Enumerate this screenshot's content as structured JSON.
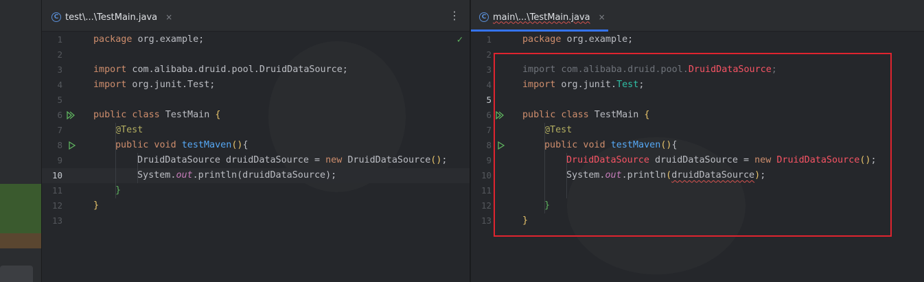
{
  "left_pane": {
    "tab": {
      "icon": "class-c-icon",
      "label": "test\\...\\TestMain.java",
      "close": "×"
    },
    "menu_icon": "⋮",
    "status_icon": "✓",
    "lines": [
      {
        "n": "1",
        "t": "package org.example;"
      },
      {
        "n": "2",
        "t": ""
      },
      {
        "n": "3",
        "t": "import com.alibaba.druid.pool.DruidDataSource;"
      },
      {
        "n": "4",
        "t": "import org.junit.Test;"
      },
      {
        "n": "5",
        "t": ""
      },
      {
        "n": "6",
        "t": "public class TestMain {"
      },
      {
        "n": "7",
        "t": "@Test"
      },
      {
        "n": "8",
        "t": "public void testMaven(){"
      },
      {
        "n": "9",
        "t": "DruidDataSource druidDataSource = new DruidDataSource();"
      },
      {
        "n": "10",
        "t": "System.out.println(druidDataSource);"
      },
      {
        "n": "11",
        "t": "}"
      },
      {
        "n": "12",
        "t": "}"
      },
      {
        "n": "13",
        "t": ""
      }
    ]
  },
  "right_pane": {
    "tab": {
      "icon": "class-c-icon",
      "label": "main\\...\\TestMain.java",
      "close": "×"
    },
    "lines": [
      {
        "n": "1",
        "t": "package org.example;"
      },
      {
        "n": "2",
        "t": ""
      },
      {
        "n": "3",
        "t": "import com.alibaba.druid.pool.DruidDataSource;"
      },
      {
        "n": "4",
        "t": "import org.junit.Test;"
      },
      {
        "n": "5",
        "t": ""
      },
      {
        "n": "6",
        "t": "public class TestMain {"
      },
      {
        "n": "7",
        "t": "@Test"
      },
      {
        "n": "8",
        "t": "public void testMaven(){"
      },
      {
        "n": "9",
        "t": "DruidDataSource druidDataSource = new DruidDataSource();"
      },
      {
        "n": "10",
        "t": "System.out.println(druidDataSource);"
      },
      {
        "n": "11",
        "t": ""
      },
      {
        "n": "12",
        "t": "}"
      },
      {
        "n": "13",
        "t": "}"
      }
    ]
  },
  "colors": {
    "keyword": "#cf8e6d",
    "annotation": "#b3ae60",
    "method": "#56a8f5",
    "unresolved": "#f75464",
    "highlight_box": "#e0242f",
    "tab_accent": "#3574f0"
  }
}
